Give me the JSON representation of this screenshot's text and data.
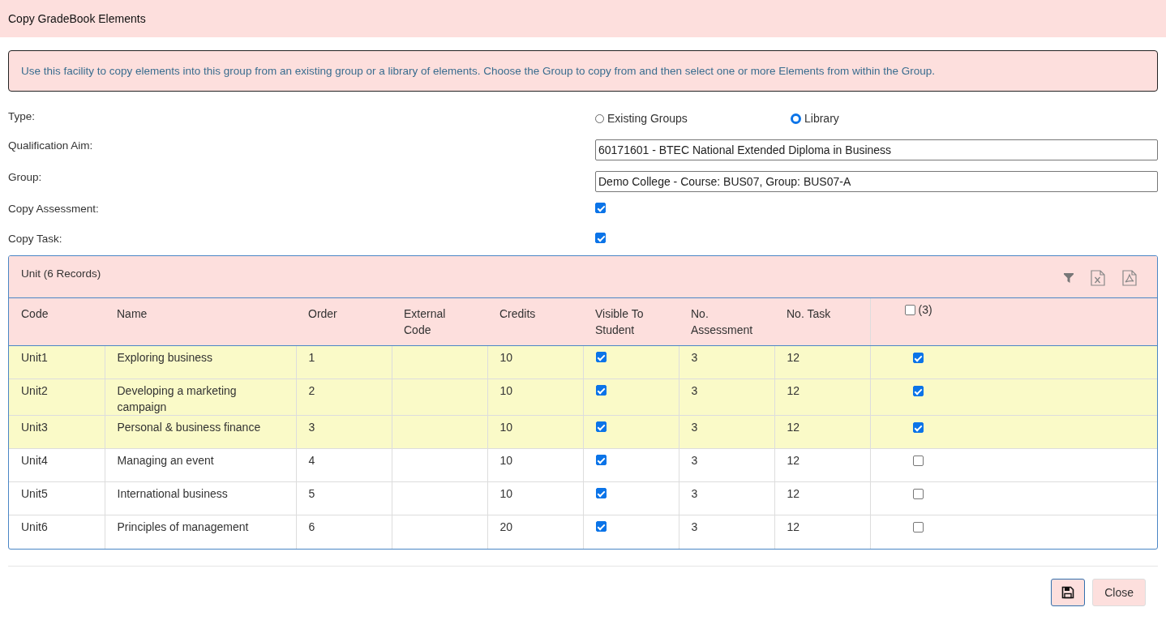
{
  "window": {
    "title": "Copy GradeBook Elements"
  },
  "info": "Use this facility to copy elements into this group from an existing group or a library of elements. Choose the Group to copy from and then select one or more Elements from within the Group.",
  "form": {
    "type": {
      "label": "Type:",
      "options": [
        {
          "label": "Existing Groups",
          "selected": false
        },
        {
          "label": "Library",
          "selected": true
        }
      ]
    },
    "qualification_aim": {
      "label": "Qualification Aim:",
      "value": "60171601 - BTEC National Extended Diploma in Business"
    },
    "group": {
      "label": "Group:",
      "value": "Demo College - Course: BUS07, Group: BUS07-A"
    },
    "copy_assessment": {
      "label": "Copy Assessment:",
      "checked": true
    },
    "copy_task": {
      "label": "Copy Task:",
      "checked": true
    }
  },
  "table": {
    "title": "Unit (6 Records)",
    "columns": [
      "Code",
      "Name",
      "Order",
      "External Code",
      "Credits",
      "Visible To Student",
      "No. Assessment",
      "No. Task"
    ],
    "select_all": {
      "checked": false,
      "count": "(3)"
    },
    "rows": [
      {
        "code": "Unit1",
        "name": "Exploring business",
        "order": "1",
        "external_code": "",
        "credits": "10",
        "visible": true,
        "assessments": "3",
        "tasks": "12",
        "selected": true
      },
      {
        "code": "Unit2",
        "name": "Developing a marketing campaign",
        "order": "2",
        "external_code": "",
        "credits": "10",
        "visible": true,
        "assessments": "3",
        "tasks": "12",
        "selected": true
      },
      {
        "code": "Unit3",
        "name": "Personal & business finance",
        "order": "3",
        "external_code": "",
        "credits": "10",
        "visible": true,
        "assessments": "3",
        "tasks": "12",
        "selected": true
      },
      {
        "code": "Unit4",
        "name": "Managing an event",
        "order": "4",
        "external_code": "",
        "credits": "10",
        "visible": true,
        "assessments": "3",
        "tasks": "12",
        "selected": false
      },
      {
        "code": "Unit5",
        "name": "International business",
        "order": "5",
        "external_code": "",
        "credits": "10",
        "visible": true,
        "assessments": "3",
        "tasks": "12",
        "selected": false
      },
      {
        "code": "Unit6",
        "name": "Principles of management",
        "order": "6",
        "external_code": "",
        "credits": "20",
        "visible": true,
        "assessments": "3",
        "tasks": "12",
        "selected": false
      }
    ]
  },
  "buttons": {
    "close": "Close"
  }
}
